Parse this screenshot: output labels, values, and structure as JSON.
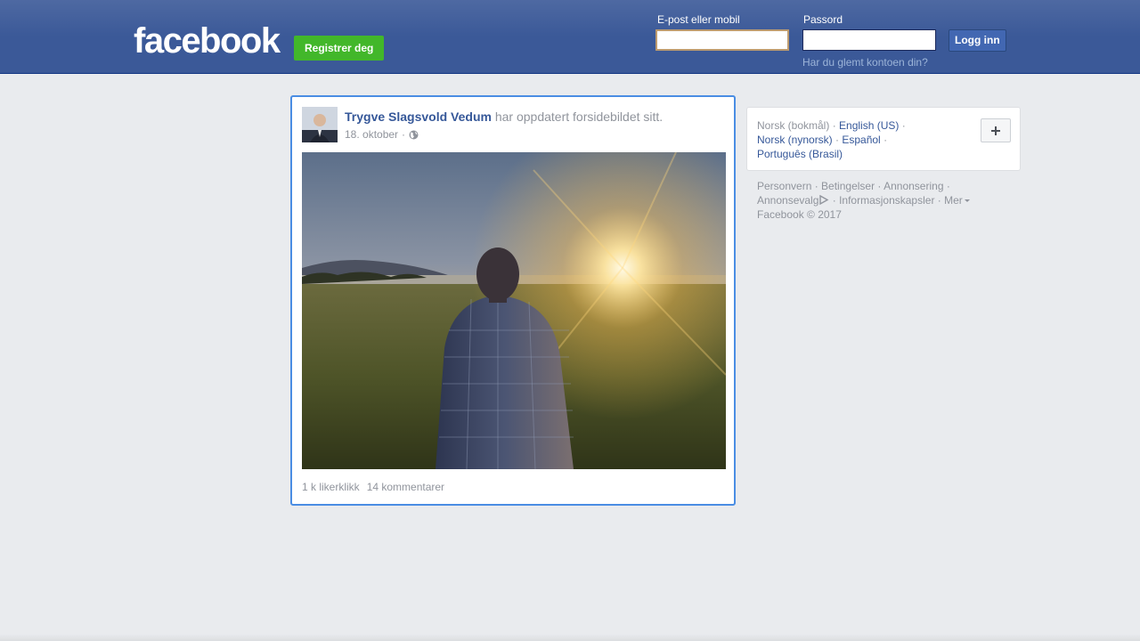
{
  "header": {
    "logo_text": "facebook",
    "signup_label": "Registrer deg",
    "email_label": "E-post eller mobil",
    "email_value": "",
    "password_label": "Passord",
    "password_value": "",
    "login_label": "Logg inn",
    "forgot_label": "Har du glemt kontoen din?"
  },
  "post": {
    "author": "Trygve Slagsvold Vedum",
    "action": "har oppdatert forsidebildet sitt.",
    "date": "18. oktober",
    "separator": "·",
    "privacy_icon": "globe-icon",
    "likes": "1 k likerklikk",
    "comments": "14 kommentarer"
  },
  "languages": {
    "current": "Norsk (bokmål)",
    "items": [
      "English (US)",
      "Norsk (nynorsk)",
      "Español",
      "Português (Brasil)"
    ],
    "more_icon": "plus-icon"
  },
  "footer": {
    "links": [
      "Personvern",
      "Betingelser",
      "Annonsering",
      "Annonsevalg",
      "Informasjonskapsler",
      "Mer"
    ],
    "copyright": "Facebook © 2017"
  },
  "colors": {
    "brand_blue": "#3b5998",
    "signup_green": "#42b72a",
    "link_blue": "#365899",
    "focus_border": "#4a8de3"
  }
}
